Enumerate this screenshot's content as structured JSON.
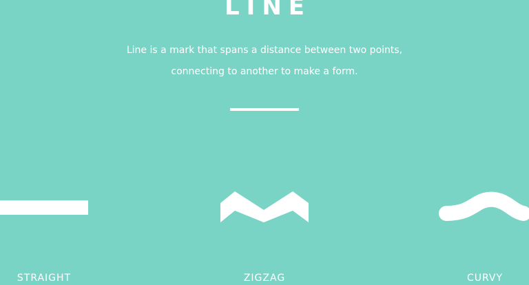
{
  "header": {
    "title": "LINE",
    "description_line1": "Line is a mark that spans a distance between two points,",
    "description_line2": "connecting to another to make a form."
  },
  "shapes": [
    {
      "label": "STRAIGHT",
      "icon": "straight-line-icon"
    },
    {
      "label": "ZIGZAG",
      "icon": "zigzag-line-icon"
    },
    {
      "label": "CURVY",
      "icon": "curvy-line-icon"
    }
  ],
  "colors": {
    "background": "#7ad4c6",
    "foreground": "#ffffff"
  }
}
